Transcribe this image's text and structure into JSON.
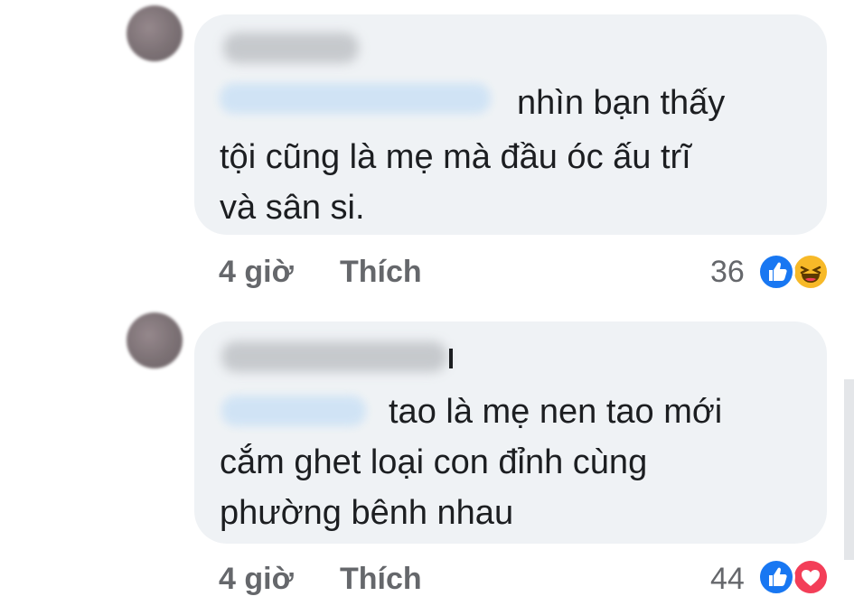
{
  "comments": [
    {
      "text_lines": [
        "nhìn bạn thấy",
        "tội cũng là mẹ mà đầu óc ấu trĩ",
        "và sân si."
      ],
      "time": "4 giờ",
      "like_label": "Thích",
      "reaction_count": "36",
      "reactions": [
        "like-icon",
        "haha-icon"
      ]
    },
    {
      "text_lines": [
        "tao là mẹ nen tao mới",
        "cắm ghet loại con đỉnh cùng",
        "phường bênh nhau"
      ],
      "time": "4 giờ",
      "like_label": "Thích",
      "reaction_count": "44",
      "reactions": [
        "like-icon",
        "love-icon"
      ]
    }
  ],
  "colors": {
    "bubble": "#eff2f5",
    "meta_text": "#65676b",
    "body_text": "#1c1e21",
    "like_blue": "#1877f2",
    "love_red": "#f33e58",
    "haha_yellow": "#f7b928"
  }
}
